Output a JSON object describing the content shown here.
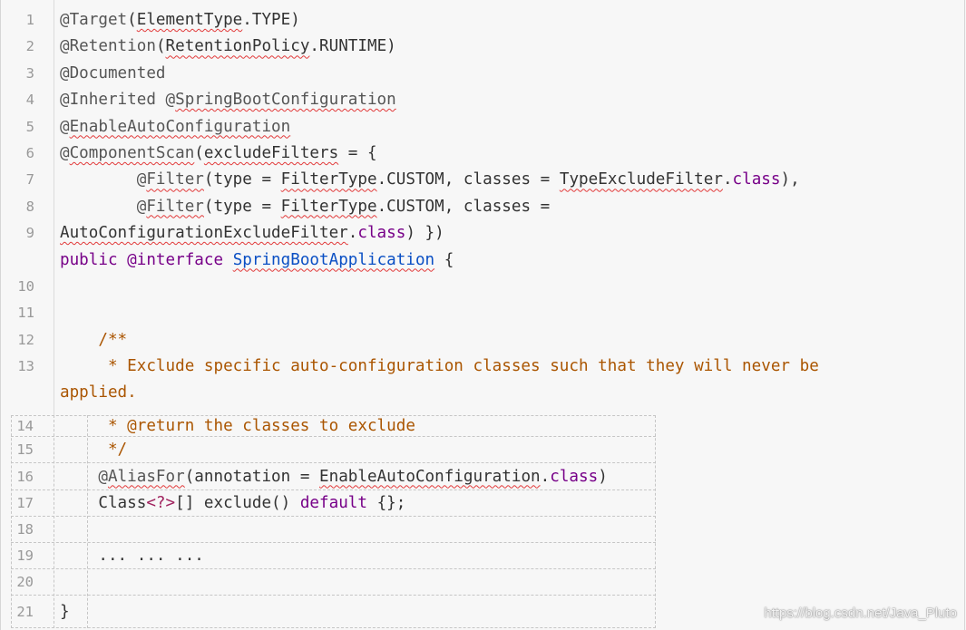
{
  "theme": {
    "background": "#f7f7f7",
    "text": "#333333",
    "annotation": "#555555",
    "keyword": "#770088",
    "definition": "#0a4fc4",
    "comment": "#aa5500",
    "generic": "#a0225e",
    "line_number": "#999999",
    "grid": "#c6c6c6",
    "spellcheck": "#e23a3a",
    "gutter_line": "#dcdcdc"
  },
  "upper_rows": [
    {
      "num": "1",
      "lines": [
        [
          {
            "t": "@Target",
            "c": "annotation"
          },
          {
            "t": "(",
            "c": "plain"
          },
          {
            "t": "ElementType",
            "c": "plain",
            "sp": true
          },
          {
            "t": ".TYPE)",
            "c": "plain"
          }
        ]
      ]
    },
    {
      "num": "2",
      "lines": [
        [
          {
            "t": "@Retention",
            "c": "annotation"
          },
          {
            "t": "(",
            "c": "plain"
          },
          {
            "t": "RetentionPolicy",
            "c": "plain",
            "sp": true
          },
          {
            "t": ".RUNTIME)",
            "c": "plain"
          }
        ]
      ]
    },
    {
      "num": "3",
      "lines": [
        [
          {
            "t": "@Documented",
            "c": "annotation"
          }
        ]
      ]
    },
    {
      "num": "4",
      "lines": [
        [
          {
            "t": "@Inherited @",
            "c": "annotation"
          },
          {
            "t": "SpringBootConfiguration",
            "c": "annotation",
            "sp": true
          }
        ]
      ]
    },
    {
      "num": "5",
      "lines": [
        [
          {
            "t": "@",
            "c": "annotation"
          },
          {
            "t": "EnableAutoConfiguration",
            "c": "annotation",
            "sp": true
          }
        ]
      ]
    },
    {
      "num": "6",
      "lines": [
        [
          {
            "t": "@",
            "c": "annotation"
          },
          {
            "t": "ComponentScan",
            "c": "annotation",
            "sp": true
          },
          {
            "t": "(",
            "c": "plain"
          },
          {
            "t": "excludeFilters",
            "c": "plain",
            "sp": true
          },
          {
            "t": " = {",
            "c": "plain"
          }
        ]
      ]
    },
    {
      "num": "7",
      "lines": [
        [
          {
            "t": "        @",
            "c": "annotation"
          },
          {
            "t": "Filter",
            "c": "annotation",
            "sp": true
          },
          {
            "t": "(type = ",
            "c": "plain"
          },
          {
            "t": "FilterType",
            "c": "plain",
            "sp": true
          },
          {
            "t": ".CUSTOM, classes = ",
            "c": "plain"
          },
          {
            "t": "TypeExcludeFilter",
            "c": "plain",
            "sp": true
          },
          {
            "t": ".",
            "c": "plain"
          },
          {
            "t": "class",
            "c": "keyword"
          },
          {
            "t": "),",
            "c": "plain"
          }
        ]
      ]
    },
    {
      "num": "8",
      "lines": [
        [
          {
            "t": "        @",
            "c": "annotation"
          },
          {
            "t": "Filter",
            "c": "annotation",
            "sp": true
          },
          {
            "t": "(type = ",
            "c": "plain"
          },
          {
            "t": "FilterType",
            "c": "plain",
            "sp": true
          },
          {
            "t": ".CUSTOM, classes =",
            "c": "plain"
          }
        ]
      ]
    },
    {
      "num": "9",
      "lines": [
        [
          {
            "t": "AutoConfigurationExcludeFilter",
            "c": "plain",
            "sp": true
          },
          {
            "t": ".",
            "c": "plain"
          },
          {
            "t": "class",
            "c": "keyword"
          },
          {
            "t": ") })",
            "c": "plain"
          }
        ],
        [
          {
            "t": "public",
            "c": "keyword"
          },
          {
            "t": " ",
            "c": "plain"
          },
          {
            "t": "@interface",
            "c": "keyword"
          },
          {
            "t": " ",
            "c": "plain"
          },
          {
            "t": "SpringBootApplication",
            "c": "definition",
            "sp": true
          },
          {
            "t": " {",
            "c": "plain"
          }
        ]
      ]
    },
    {
      "num": "10",
      "lines": [
        []
      ]
    },
    {
      "num": "11",
      "lines": [
        []
      ]
    },
    {
      "num": "12",
      "lines": [
        [
          {
            "t": "    /**",
            "c": "comment"
          }
        ]
      ]
    },
    {
      "num": "13",
      "lines": [
        [
          {
            "t": "     * Exclude specific auto-configuration classes such that they will never be",
            "c": "comment"
          }
        ],
        [
          {
            "t": "applied.",
            "c": "comment"
          }
        ]
      ]
    }
  ],
  "lower_rows": [
    {
      "num": "14",
      "lines": [
        [
          {
            "t": "     * @return the classes to exclude",
            "c": "comment"
          }
        ]
      ]
    },
    {
      "num": "15",
      "lines": [
        [
          {
            "t": "     */",
            "c": "comment"
          }
        ]
      ]
    },
    {
      "num": "16",
      "lines": [
        [
          {
            "t": "    @",
            "c": "annotation"
          },
          {
            "t": "AliasFor",
            "c": "annotation",
            "sp": true
          },
          {
            "t": "(annotation = ",
            "c": "plain"
          },
          {
            "t": "EnableAutoConfiguration",
            "c": "plain",
            "sp": true
          },
          {
            "t": ".",
            "c": "plain"
          },
          {
            "t": "class",
            "c": "keyword"
          },
          {
            "t": ")",
            "c": "plain"
          }
        ]
      ]
    },
    {
      "num": "17",
      "lines": [
        [
          {
            "t": "    Class",
            "c": "plain"
          },
          {
            "t": "<?>",
            "c": "generic"
          },
          {
            "t": "[] exclude() ",
            "c": "plain"
          },
          {
            "t": "default",
            "c": "keyword"
          },
          {
            "t": " {};",
            "c": "plain"
          }
        ]
      ]
    },
    {
      "num": "18",
      "lines": [
        []
      ]
    },
    {
      "num": "19",
      "lines": [
        [
          {
            "t": "    ... ... ...",
            "c": "plain"
          }
        ]
      ]
    },
    {
      "num": "20",
      "lines": [
        []
      ]
    },
    {
      "num": "21",
      "lines": [
        [
          {
            "t": "}",
            "c": "plain"
          }
        ]
      ]
    }
  ],
  "watermark": "https://blog.csdn.net/Java_Pluto"
}
